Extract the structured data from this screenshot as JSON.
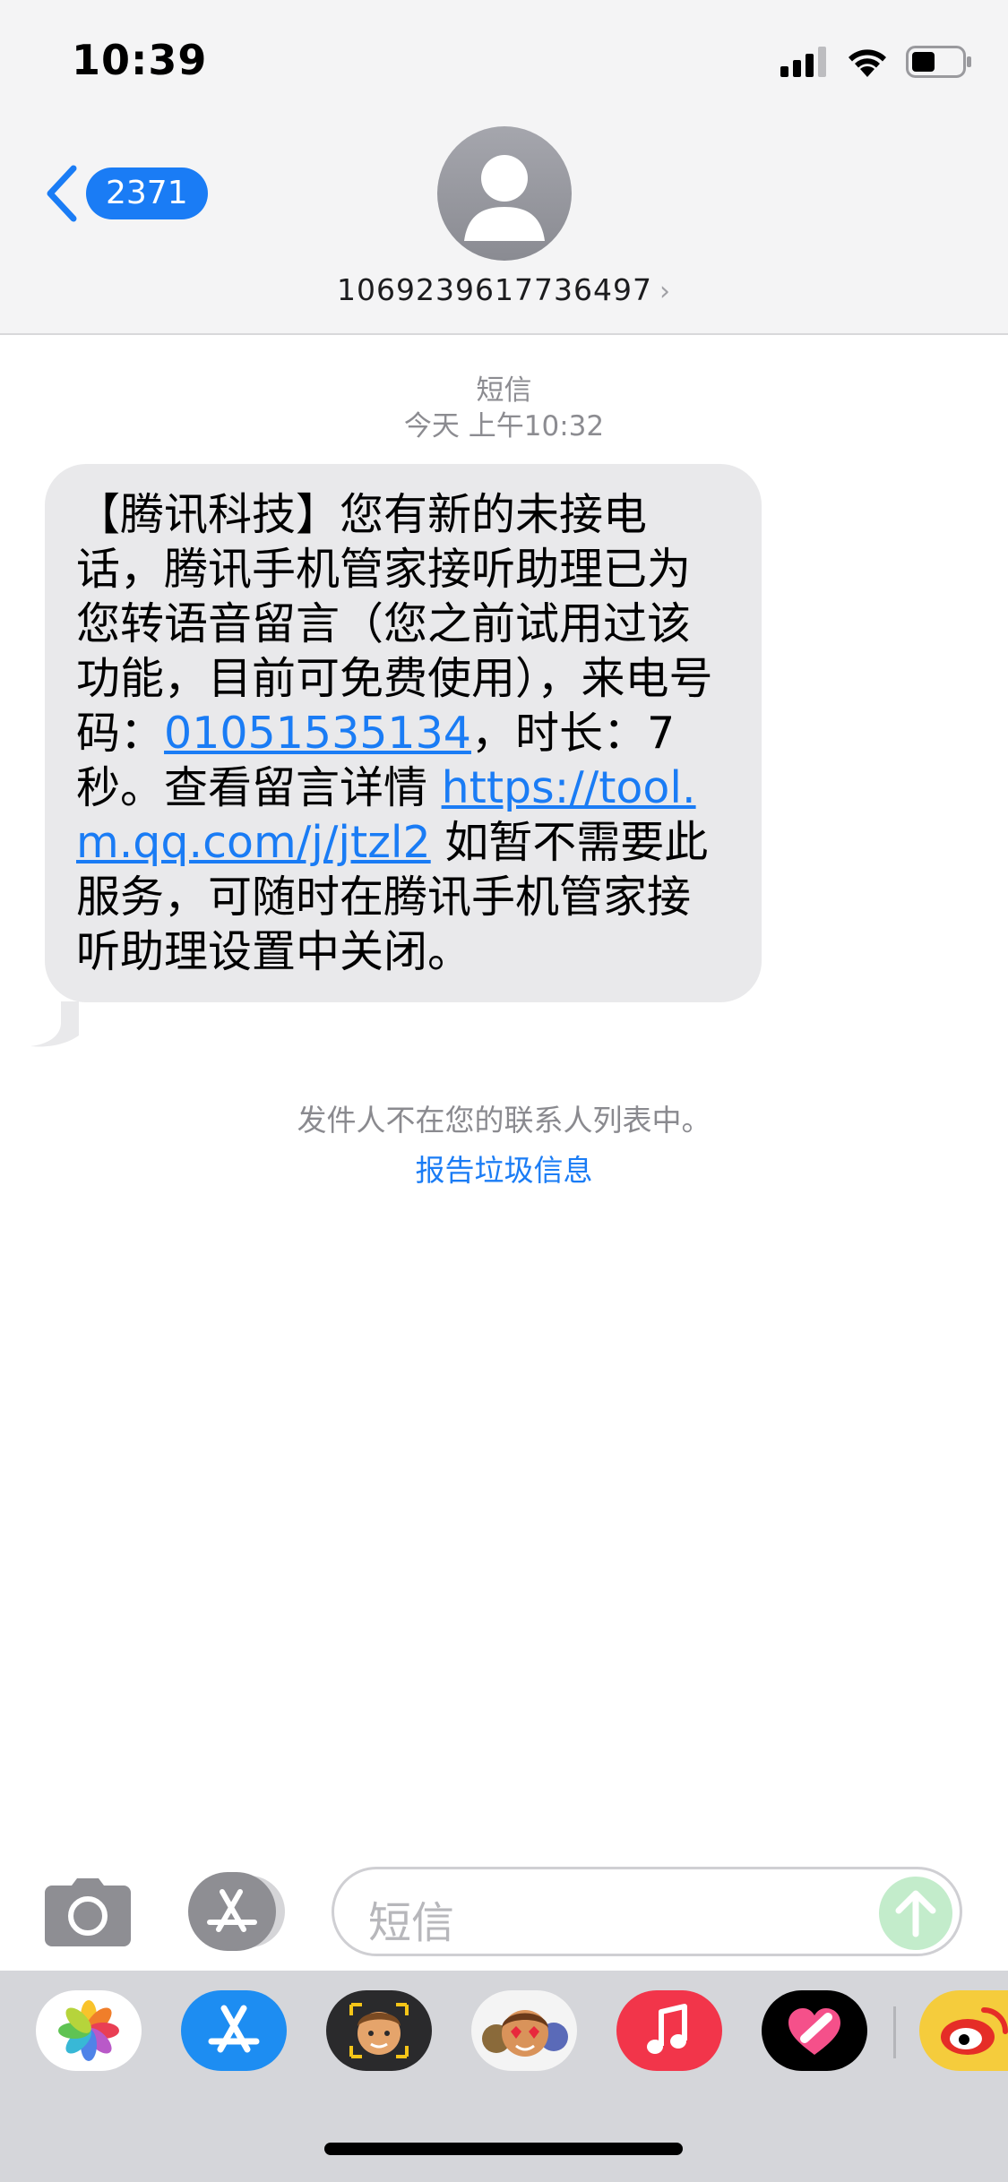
{
  "status_bar": {
    "time": "10:39"
  },
  "header": {
    "back_count": "2371",
    "contact_number": "1069239617736497",
    "chevron": "›"
  },
  "conversation": {
    "service_label": "短信",
    "timestamp": "今天 上午10:32",
    "message": {
      "part1": "【腾讯科技】您有新的未接电话，腾讯手机管家接听助理已为您转语音留言（您之前试用过该功能，目前可免费使用），来电号码：",
      "phone_link": "01051535134",
      "part2": "，时长：7秒。查看留言详情 ",
      "url_link": "https://tool.m.qq.com/j/jtzl2",
      "part3": " 如暂不需要此服务，可随时在腾讯手机管家接听助理设置中关闭。"
    },
    "notice": "发件人不在您的联系人列表中。",
    "report_label": "报告垃圾信息"
  },
  "input_bar": {
    "placeholder": "短信"
  },
  "app_drawer": {
    "apps": [
      "photos-icon",
      "app-store-icon",
      "memoji-icon",
      "animoji-icon",
      "music-icon",
      "digital-touch-icon",
      "weibo-icon"
    ]
  },
  "colors": {
    "accent": "#1a7cf5",
    "bubble_bg": "#e9e9eb",
    "header_bg": "#f4f4f5",
    "drawer_bg": "#d5d6da",
    "send_button": "#c3eccb"
  }
}
